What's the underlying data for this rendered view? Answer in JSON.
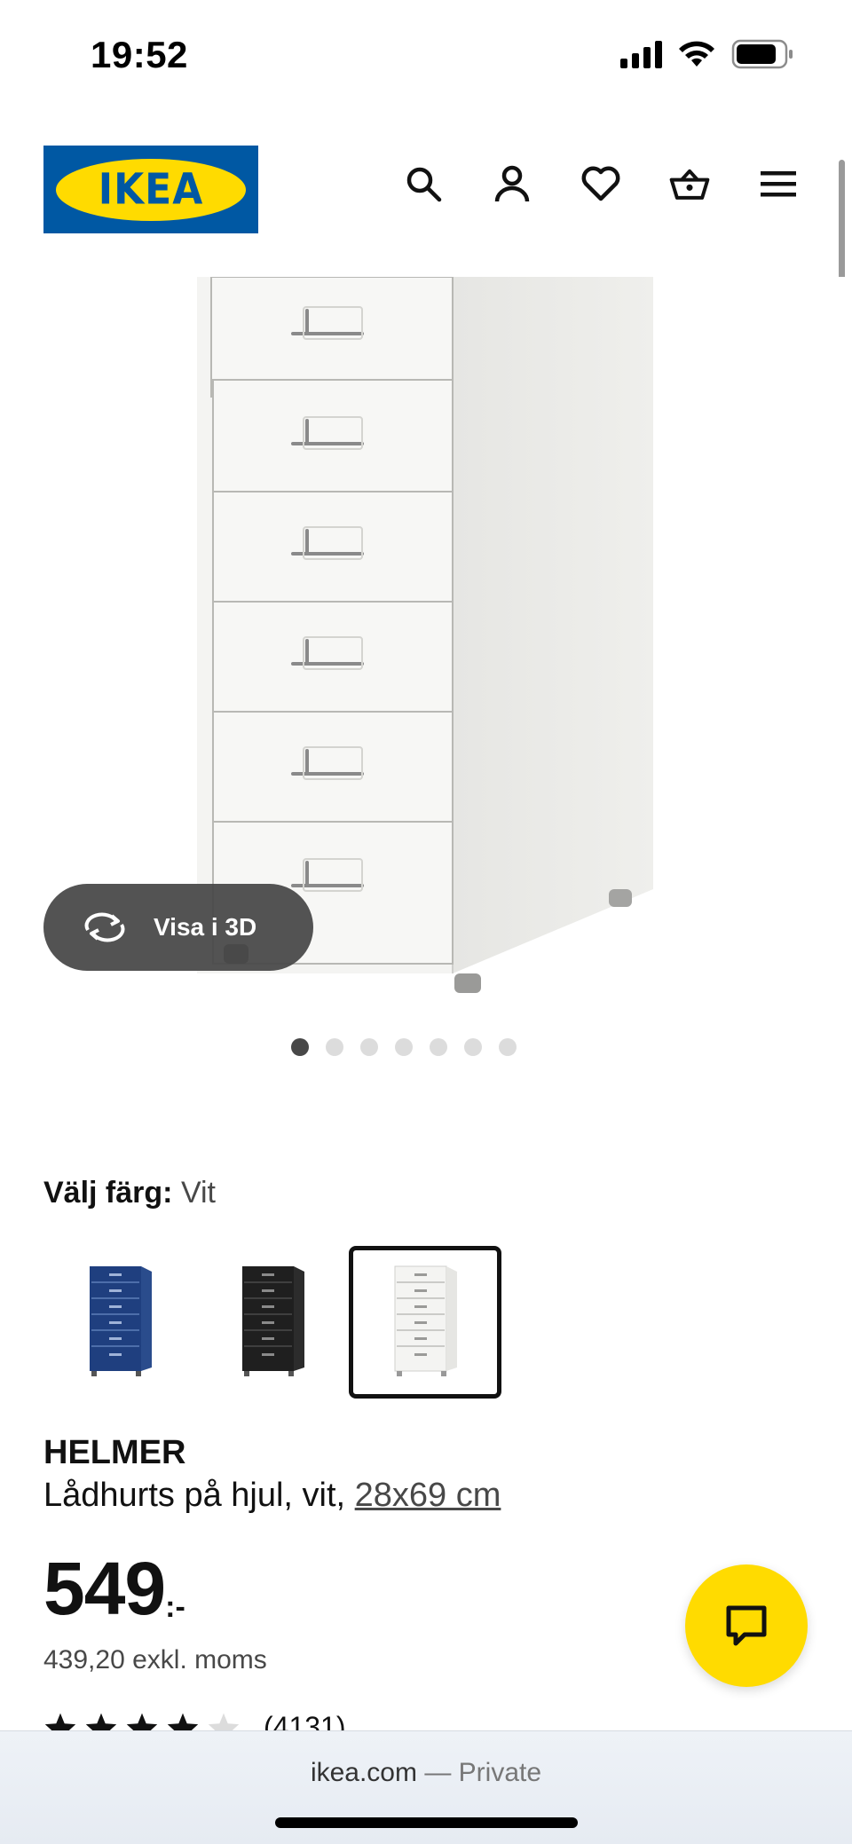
{
  "status_bar": {
    "time": "19:52"
  },
  "header": {
    "logo_text": "IKEA",
    "icons": [
      "search-icon",
      "account-icon",
      "heart-icon",
      "basket-icon",
      "menu-icon"
    ]
  },
  "gallery": {
    "view3d_label": "Visa i 3D",
    "dot_count": 7,
    "active_dot": 1
  },
  "color_select": {
    "label": "Välj färg:",
    "value": "Vit",
    "swatches": [
      {
        "name": "blå",
        "color": "#1f3f7f"
      },
      {
        "name": "svart",
        "color": "#1f1f1f"
      },
      {
        "name": "vit",
        "color": "#f1f1ef",
        "selected": true
      }
    ]
  },
  "product": {
    "name": "HELMER",
    "description": "Lådhurts på hjul, vit,",
    "size_link": "28x69 cm",
    "price": "549",
    "price_suffix": ":-",
    "price_ex_vat": "439,20 exkl. moms",
    "rating_stars": 4,
    "rating_count": "(4131)"
  },
  "browser": {
    "domain": "ikea.com",
    "separator": "—",
    "mode": "Private"
  },
  "colors": {
    "ikea_blue": "#0058a3",
    "ikea_yellow": "#ffdb00"
  }
}
